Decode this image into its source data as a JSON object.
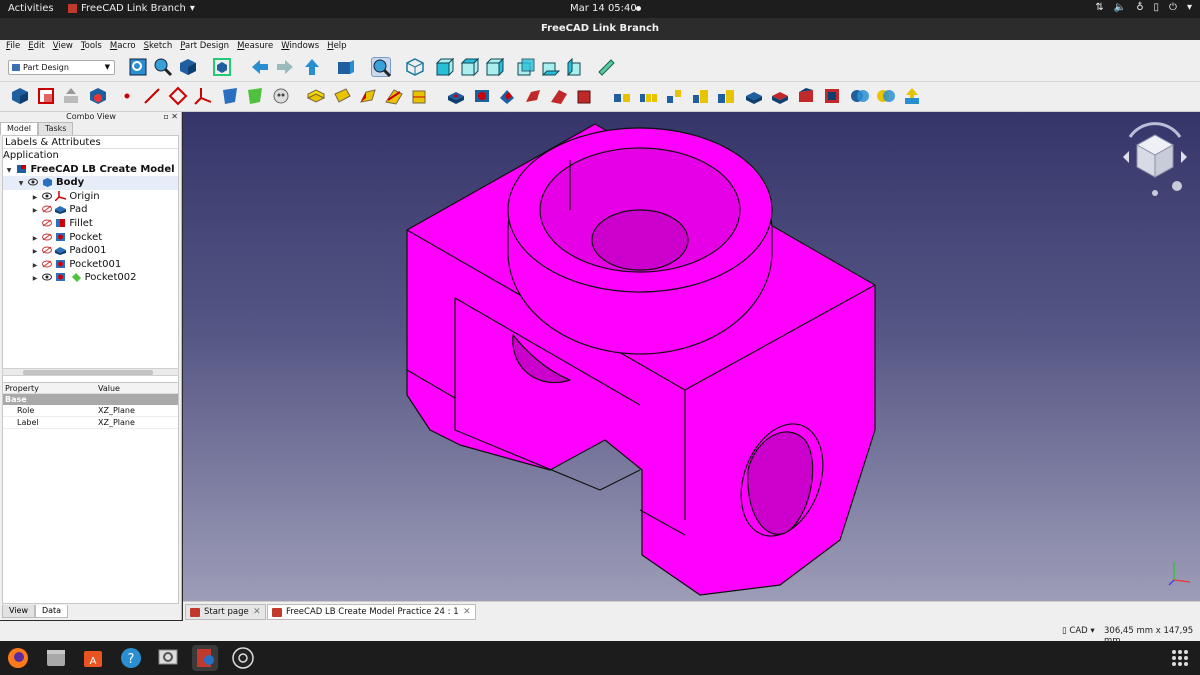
{
  "topbar": {
    "activities": "Activities",
    "app_name": "FreeCAD Link Branch",
    "clock": "Mar 14  05:40"
  },
  "window": {
    "title": "FreeCAD Link Branch"
  },
  "menu": [
    "File",
    "Edit",
    "View",
    "Tools",
    "Macro",
    "Sketch",
    "Part Design",
    "Measure",
    "Windows",
    "Help"
  ],
  "workbench": {
    "selected": "Part Design"
  },
  "combo": {
    "title": "Combo View",
    "tabs": [
      "Model",
      "Tasks"
    ],
    "tree_header": "Labels & Attributes",
    "application": "Application",
    "document": "FreeCAD LB Create Model",
    "body": "Body",
    "features": [
      "Origin",
      "Pad",
      "Fillet",
      "Pocket",
      "Pad001",
      "Pocket001",
      "Pocket002"
    ],
    "props_headers": [
      "Property",
      "Value"
    ],
    "props_group": "Base",
    "props": [
      {
        "k": "Role",
        "v": "XZ_Plane"
      },
      {
        "k": "Label",
        "v": "XZ_Plane"
      }
    ],
    "bottom_tabs": [
      "View",
      "Data"
    ]
  },
  "doc_tabs": [
    "Start page",
    "FreeCAD LB Create Model Practice 24 : 1"
  ],
  "status": {
    "nav": "CAD",
    "dims": "306,45 mm x 147,95 mm"
  },
  "colors": {
    "model": "#ff00ff",
    "accent": "#3c6fb7"
  }
}
